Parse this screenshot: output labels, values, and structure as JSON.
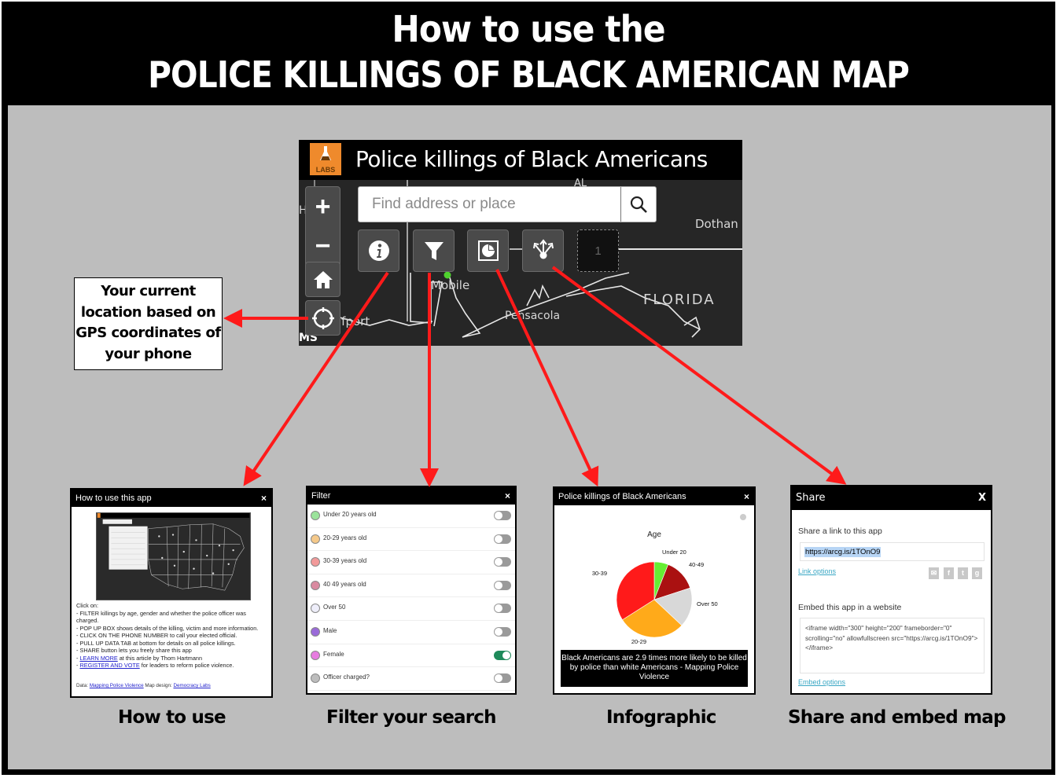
{
  "poster": {
    "title_line1": "How to use the",
    "title_line2": "POLICE KILLINGS OF BLACK AMERICAN MAP",
    "background_color": "#bdbdbd",
    "arrow_color": "#ff1a1a"
  },
  "app": {
    "logo_icon": "flask-icon",
    "logo_text": "LABS",
    "title": "Police killings of Black Americans",
    "search": {
      "placeholder": "Find address or place",
      "value": "",
      "button_icon": "search-icon"
    },
    "map_controls": {
      "zoom_in": "+",
      "zoom_out": "−",
      "home_icon": "home-icon",
      "locate_icon": "locate-icon"
    },
    "toolbar": [
      {
        "name": "about",
        "icon": "info-icon"
      },
      {
        "name": "filter",
        "icon": "filter-icon"
      },
      {
        "name": "infographic",
        "icon": "infographic-icon"
      },
      {
        "name": "share",
        "icon": "share-icon"
      }
    ],
    "placeholder_slot": "1",
    "map_labels": {
      "al": "AL",
      "hattiesburg": "H    burg",
      "dothan": "Dothan",
      "mobile": "Mobile",
      "florida": "FLORIDA",
      "pensacola": "Pensacola",
      "gulfport": "lfport",
      "ms": "MS"
    }
  },
  "callout": {
    "gps_text": "Your current location based on GPS coordinates of your phone"
  },
  "panels": {
    "howto": {
      "title": "How to use this app",
      "close": "×",
      "intro": "Click on:",
      "lines": [
        "- FILTER killings by age, gender and whether the police officer was charged.",
        "- POP UP BOX shows details of the killing, victim and more information.",
        "- CLICK ON THE PHONE NUMBER to call your elected official.",
        "- PULL UP DATA TAB at bottom for details on all police killings.",
        "- SHARE button lets you freely share this app"
      ],
      "learn_more_link": "LEARN MORE",
      "learn_more_rest": " at this article by Thom Hartmann",
      "register_link": "REGISTER AND VOTE",
      "register_rest": " for leaders to reform police violence.",
      "footer_data_label": "Data: ",
      "footer_data_link": "Mapping Police Violence",
      "footer_design_label": " Map design: ",
      "footer_design_link": "Democracy Labs"
    },
    "filter": {
      "title": "Filter",
      "close": "×",
      "items": [
        {
          "label": "Under 20 years old",
          "color": "#9be39b",
          "on": false
        },
        {
          "label": "20-29 years old",
          "color": "#f5c98a",
          "on": false
        },
        {
          "label": "30-39 years old",
          "color": "#f29a9a",
          "on": false
        },
        {
          "label": "40 49 years old",
          "color": "#d98aa0",
          "on": false
        },
        {
          "label": "Over 50",
          "color": "#eeeefa",
          "on": false
        },
        {
          "label": "Male",
          "color": "#9a6ad9",
          "on": false
        },
        {
          "label": "Female",
          "color": "#e77be0",
          "on": true
        },
        {
          "label": "Officer charged?",
          "color": "#bdbdbd",
          "on": false
        }
      ]
    },
    "infographic": {
      "title": "Police killings of Black Americans",
      "close": "×",
      "banner": "Black Americans are 2.9 times more likely to be killed by police than white Americans - Mapping Police Violence"
    },
    "share": {
      "title": "Share",
      "close": "X",
      "link_label": "Share a link to this app",
      "link_value": "https://arcg.is/1TOnO9",
      "link_options": "Link options",
      "social": [
        "email-icon",
        "facebook-icon",
        "twitter-icon",
        "google-plus-icon"
      ],
      "embed_label": "Embed this app in a website",
      "embed_code": "<iframe width=\"300\" height=\"200\" frameborder=\"0\" scrolling=\"no\" allowfullscreen src=\"https://arcg.is/1TOnO9\"></iframe>",
      "embed_options": "Embed options"
    }
  },
  "captions": {
    "howto": "How to use",
    "filter": "Filter your search",
    "infographic": "Infographic",
    "share": "Share and embed map"
  },
  "chart_data": {
    "type": "pie",
    "title": "Age",
    "categories": [
      "Under 20",
      "40-49",
      "Over 50",
      "20-29",
      "30-39"
    ],
    "values": [
      6,
      14,
      17,
      29,
      34
    ],
    "colors": [
      "#66ee33",
      "#aa1111",
      "#d8d8d8",
      "#ffaa1a",
      "#ff1a1a"
    ],
    "units": "approx. percent of total",
    "legend": "labels-on-slices"
  }
}
